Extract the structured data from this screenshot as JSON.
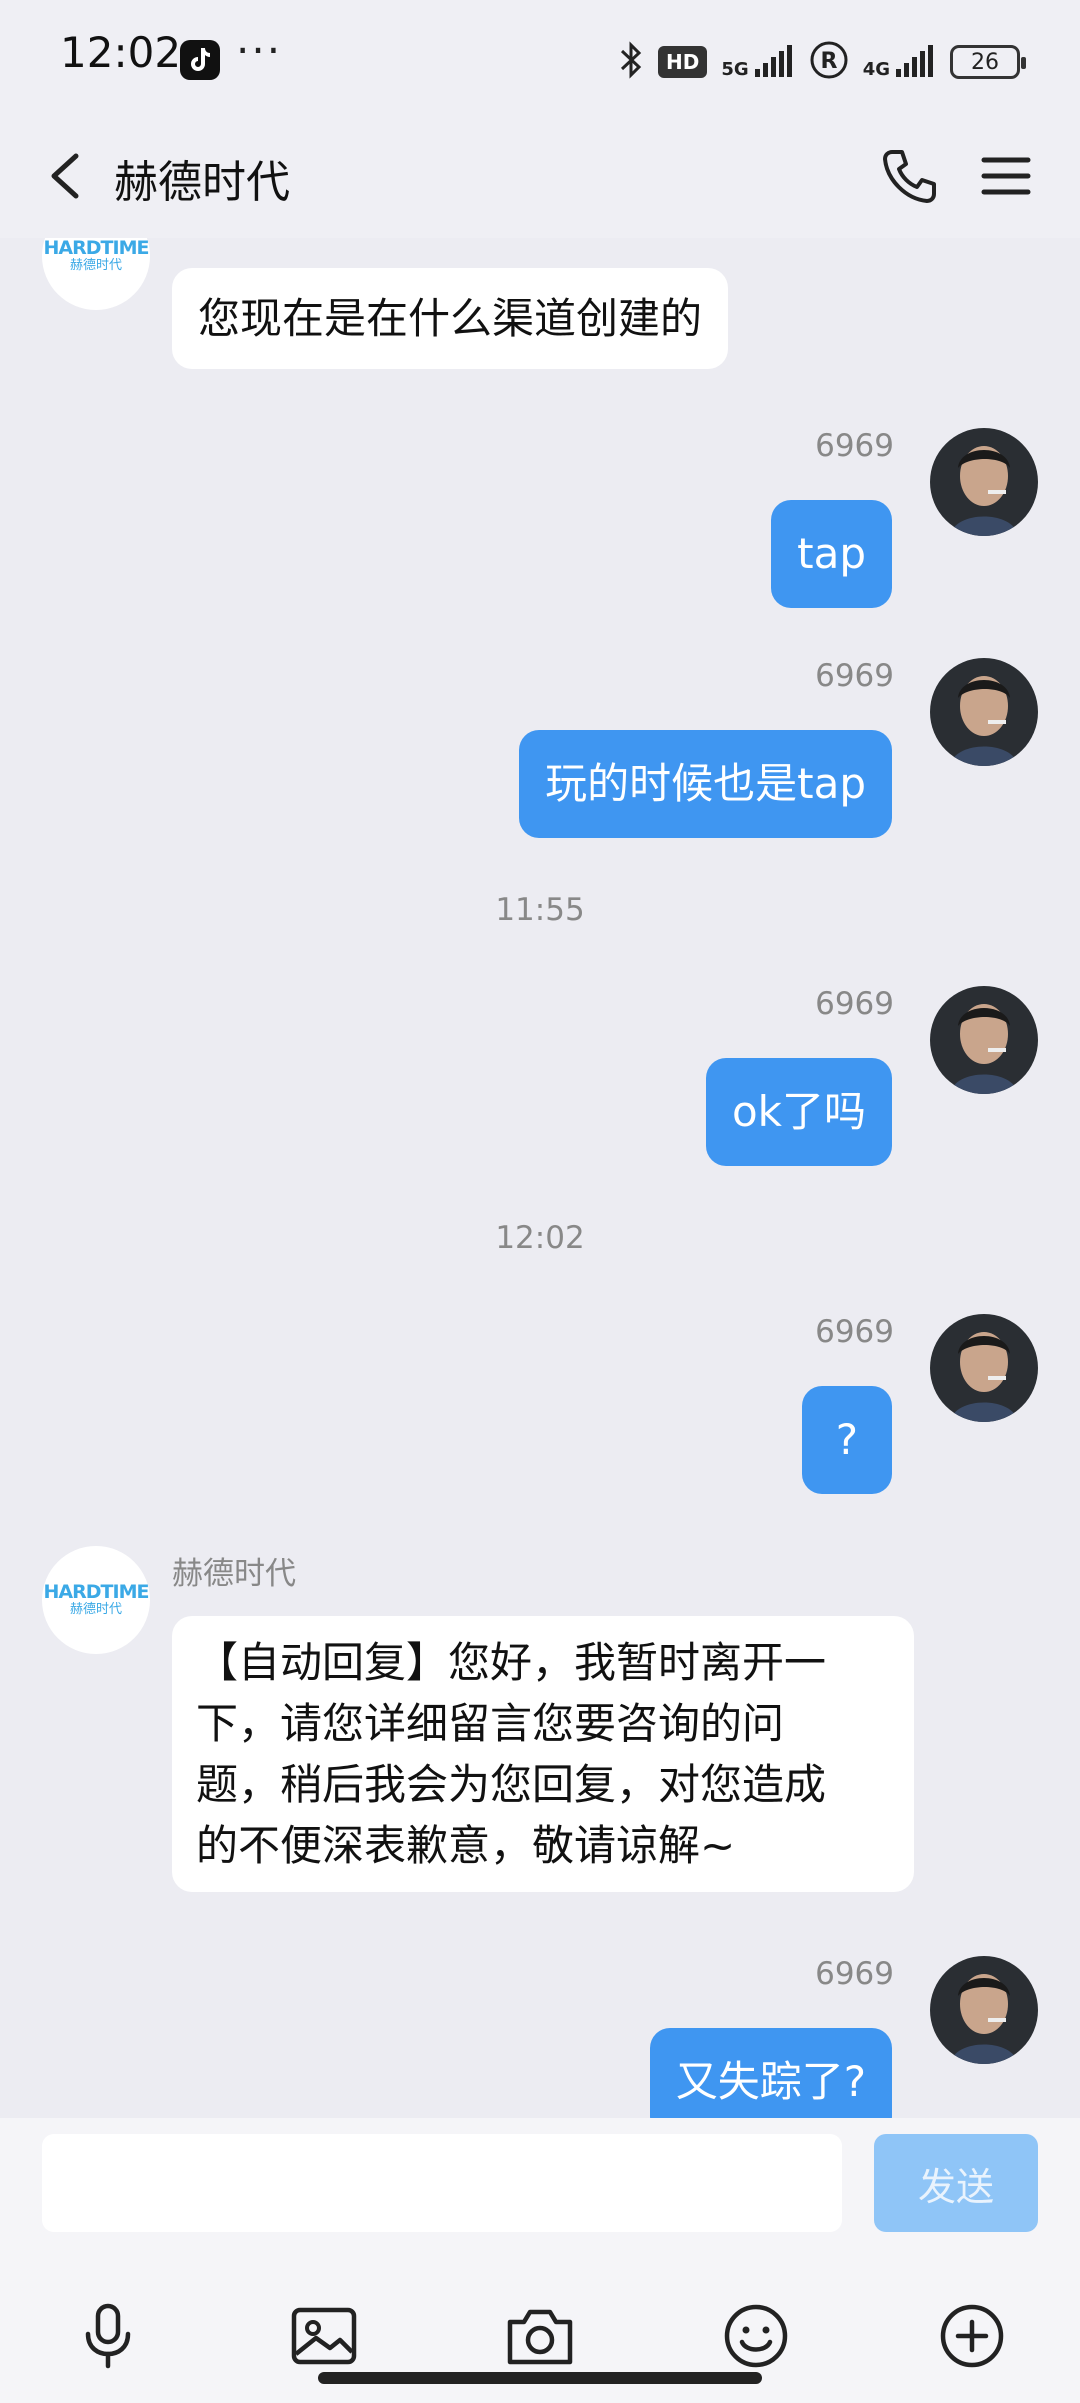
{
  "status_bar": {
    "time": "12:02",
    "dots": "···",
    "hd_badge": "HD",
    "net_5g": "5G",
    "net_4g": "4G",
    "battery": "26"
  },
  "header": {
    "title": "赫德时代"
  },
  "brand_avatar": {
    "top": "HARDTIME",
    "bottom": "赫德时代"
  },
  "messages": [
    {
      "side": "in",
      "text": "您现在是在什么渠道创建的"
    },
    {
      "side": "out",
      "sender": "6969",
      "text": "tap"
    },
    {
      "side": "out",
      "sender": "6969",
      "text": "玩的时候也是tap"
    },
    {
      "time": "11:55"
    },
    {
      "side": "out",
      "sender": "6969",
      "text": "ok了吗"
    },
    {
      "time": "12:02"
    },
    {
      "side": "out",
      "sender": "6969",
      "text": "?"
    },
    {
      "side": "in",
      "sender": "赫德时代",
      "lines": [
        "【自动回复】您好，我暂时离开一",
        "下，请您详细留言您要咨询的问",
        "题，稍后我会为您回复，对您造成",
        "的不便深表歉意，敬请谅解~"
      ]
    },
    {
      "side": "out",
      "sender": "6969",
      "text": "又失踪了?"
    }
  ],
  "input": {
    "placeholder": "",
    "send_label": "发送"
  },
  "toolbar": [
    "mic-icon",
    "image-icon",
    "camera-icon",
    "emoji-icon",
    "plus-icon"
  ],
  "colors": {
    "outgoing_bubble": "#3f96f1",
    "incoming_bubble": "#ffffff",
    "send_button": "#8fc5f7",
    "brand": "#3ba9e6"
  }
}
